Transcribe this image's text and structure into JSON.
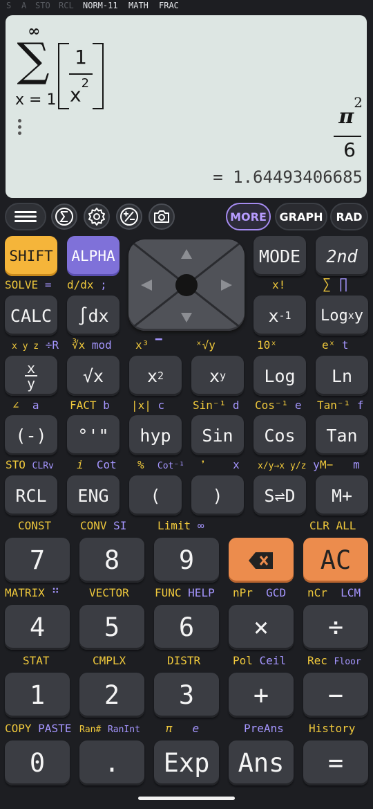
{
  "status_bar": {
    "indicators_dim": [
      "S",
      "A",
      "STO",
      "RCL"
    ],
    "indicators_lit": [
      "NORM-11",
      "MATH",
      "FRAC"
    ]
  },
  "display": {
    "input": {
      "sigma_symbol": "∑",
      "upper_limit": "∞",
      "lower_limit": "x = 1",
      "numerator": "1",
      "denominator_base": "x",
      "denominator_exponent": "2"
    },
    "result": {
      "numerator_symbol": "π",
      "numerator_exponent": "2",
      "denominator": "6",
      "decimal": "= 1.64493406685"
    }
  },
  "toolbar": {
    "icons": [
      "menu-icon",
      "sum-icon",
      "settings-icon",
      "plus-minus-icon",
      "camera-icon"
    ],
    "more": "MORE",
    "graph": "GRAPH",
    "angle_mode": "RAD"
  },
  "keys": {
    "shift": "SHIFT",
    "alpha": "ALPHA",
    "mode": "MODE",
    "second": "2nd",
    "calc": "CALC",
    "integral": "∫dx",
    "x_inverse_base": "x",
    "x_inverse_exp": "-1",
    "logxy_base": "Log",
    "logxy_sub": "x",
    "logxy_y": "y",
    "fraction_num": "x",
    "fraction_den": "y",
    "sqrt": "√x",
    "square_base": "x",
    "square_exp": "2",
    "power_base": "x",
    "power_exp": "y",
    "log": "Log",
    "ln": "Ln",
    "negative": "(-)",
    "degree": "°'\"",
    "hyp": "hyp",
    "sin": "Sin",
    "cos": "Cos",
    "tan": "Tan",
    "rcl": "RCL",
    "eng": "ENG",
    "open_paren": "(",
    "close_paren": ")",
    "s_to_d": "S⇌D",
    "m_plus": "M+",
    "n7": "7",
    "n8": "8",
    "n9": "9",
    "ac": "AC",
    "n4": "4",
    "n5": "5",
    "n6": "6",
    "multiply": "×",
    "divide": "÷",
    "n1": "1",
    "n2": "2",
    "n3": "3",
    "plus": "+",
    "minus": "−",
    "n0": "0",
    "dot": ".",
    "exp": "Exp",
    "ans": "Ans",
    "equals": "="
  },
  "labels": {
    "solve": "SOLVE",
    "solve_alpha": "=",
    "ddx": "d/dx",
    "ddx_alpha": ";",
    "x_factorial": "x!",
    "sigma_key": "∑",
    "pi_product": "∏",
    "x_y_z": "x y z",
    "to_r": "÷R",
    "cbrt": "∛x",
    "mod": "mod",
    "cube": "x³",
    "mean_bar": "▔",
    "xroot": "ˣ√y",
    "ten_x": "10ˣ",
    "e_x": "eˣ",
    "t": "t",
    "angle": "∠",
    "a": "a",
    "fact": "FACT",
    "b": "b",
    "abs": "|x|",
    "c": "c",
    "asin": "Sin⁻¹",
    "d": "d",
    "acos": "Cos⁻¹",
    "e": "e",
    "atan": "Tan⁻¹",
    "f": "f",
    "sto": "STO",
    "clrv": "CLRv",
    "i": "i",
    "cot": "Cot",
    "percent": "%",
    "acot": "Cot⁻¹",
    "comma": "❜",
    "x": "x",
    "frac_convert": "x/y→x y/z",
    "y": "y",
    "m_minus": "M−",
    "m": "m",
    "const": "CONST",
    "conv": "CONV",
    "si": "SI",
    "limit": "Limit",
    "infinity": "∞",
    "clr_all": "CLR ALL",
    "matrix": "MATRIX",
    "matrix_icon": "⠛",
    "vector": "VECTOR",
    "func": "FUNC",
    "help": "HELP",
    "npr": "nPr",
    "gcd": "GCD",
    "ncr": "nCr",
    "lcm": "LCM",
    "stat": "STAT",
    "cmplx": "CMPLX",
    "distr": "DISTR",
    "pol": "Pol",
    "ceil": "Ceil",
    "rec": "Rec",
    "floor": "Floor",
    "copy": "COPY",
    "paste": "PASTE",
    "ran_hash": "Ran#",
    "ranint": "RanInt",
    "pi": "π",
    "e_const": "e",
    "preans": "PreAns",
    "history": "History"
  },
  "colors": {
    "shift": "#f5b53a",
    "alpha": "#7f71d9",
    "accent_orange": "#ec8c4d",
    "yellow_label": "#f0c93c",
    "purple_label": "#a596ff",
    "display_bg": "#dde6e3"
  }
}
